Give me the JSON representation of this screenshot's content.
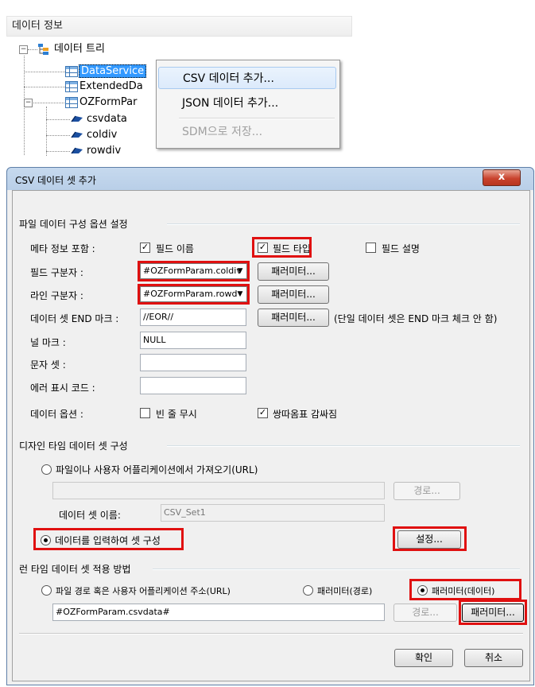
{
  "top_panel": {
    "header": "데이터 정보",
    "tree": {
      "root": "데이터 트리",
      "items": [
        "DataService",
        "ExtendedDa",
        "OZFormPar"
      ],
      "fields": [
        "csvdata",
        "coldiv",
        "rowdiv"
      ]
    },
    "context_menu": [
      "CSV 데이터 추가...",
      "JSON 데이터 추가...",
      "SDM으로 저장..."
    ]
  },
  "dialog": {
    "title": "CSV 데이터 셋 추가",
    "close_symbol": "x",
    "file_section": {
      "title": "파일 데이터 구성 옵션 설정",
      "meta_label": "메타 정보 포함 :",
      "meta_options": [
        {
          "label": "필드 이름",
          "checked": true
        },
        {
          "label": "필드 타입",
          "checked": true
        },
        {
          "label": "필드 설명",
          "checked": false
        }
      ],
      "field_sep_label": "필드 구분자 :",
      "field_sep_value": "#OZFormParam.coldiv",
      "line_sep_label": "라인 구분자 :",
      "line_sep_value": "#OZFormParam.rowd",
      "param_button": "패러미터...",
      "endmark_label": "데이터 셋 END 마크 :",
      "endmark_value": "//EOR//",
      "endmark_note": "(단일 데이터 셋은 END 마크 체크 안 함)",
      "null_label": "널 마크 :",
      "null_value": "NULL",
      "charset_label": "문자 셋 :",
      "charset_value": "",
      "error_label": "에러 표시 코드 :",
      "error_value": "",
      "data_option_label": "데이터 옵션 :",
      "data_options": [
        {
          "label": "빈 줄 무시",
          "checked": false
        },
        {
          "label": "쌍따옴표 감싸짐",
          "checked": true
        }
      ]
    },
    "design_section": {
      "title": "디자인 타임 데이터 셋 구성",
      "radio_file": "파일이나 사용자 어플리케이션에서 가져오기(URL)",
      "path_value": "",
      "path_button": "경로...",
      "dataset_name_label": "데이터 셋 이름:",
      "dataset_name_value": "CSV_Set1",
      "radio_input": "데이터를 입력하여 셋 구성",
      "settings_button": "설정..."
    },
    "runtime_section": {
      "title": "런 타임 데이터 셋 적용 방법",
      "radio_url": "파일 경로 혹은 사용자 어플리케이션 주소(URL)",
      "radio_param_path": "패러미터(경로)",
      "radio_param_data": "패러미터(데이터)",
      "value": "#OZFormParam.csvdata#",
      "path_button": "경로...",
      "param_button": "패러미터..."
    },
    "ok_button": "확인",
    "cancel_button": "취소"
  }
}
